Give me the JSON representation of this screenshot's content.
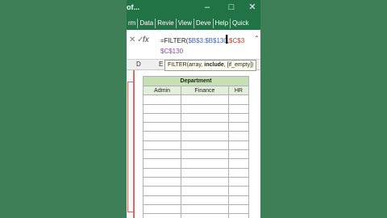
{
  "app": {
    "doc_title": "of...",
    "icons": {
      "minimize": "minimize-icon",
      "maximize": "maximize-icon",
      "close": "close-icon"
    }
  },
  "ribbon": {
    "tabs": [
      "rm",
      "Data",
      "Revie",
      "View",
      "Deve",
      "Help",
      "Quick"
    ]
  },
  "formula_bar": {
    "cancel_glyph": "✕",
    "enter_glyph": "✓",
    "fx_label": "fx",
    "parts": {
      "prefix": "=FILTER(",
      "ref1": "$B$3:$B$130",
      "comma1": ",",
      "ref2": "$C$3",
      "line2": "$C$130"
    }
  },
  "column_headers": {
    "D": "D",
    "E": "E"
  },
  "tooltip": {
    "func": "FILTER(",
    "arg1": "array",
    "sep1": ", ",
    "arg2": "include",
    "sep2": ", ",
    "arg3": "[if_empty]",
    "close": ")"
  },
  "table": {
    "title": "Department",
    "columns": [
      "Admin",
      "Finance",
      "HR"
    ],
    "empty_rows": 14
  },
  "colors": {
    "excel_green": "#217346",
    "background": "#3f7f58",
    "header_fill": "#c6e0b4"
  }
}
